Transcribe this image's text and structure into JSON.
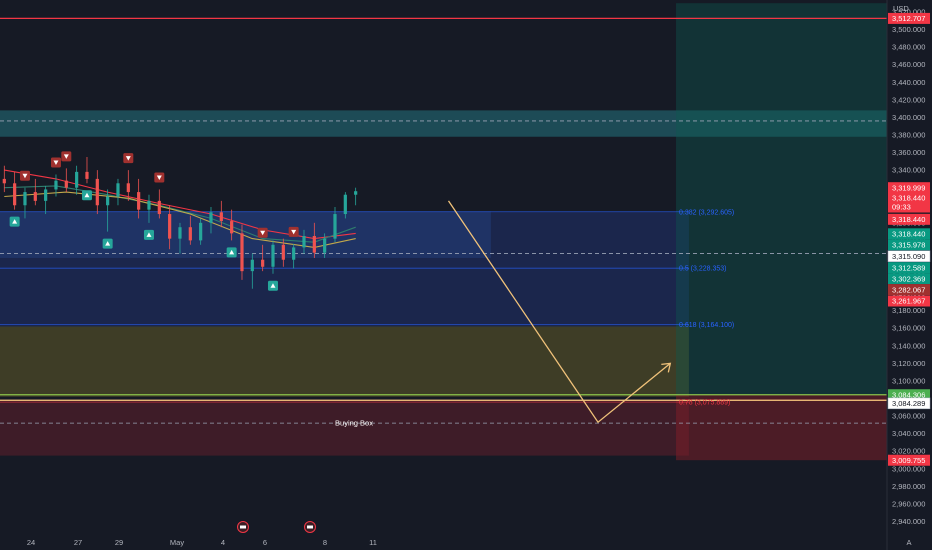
{
  "chart_data": {
    "type": "candlestick",
    "currency": "USD",
    "ylim": [
      2930,
      3530
    ],
    "y_ticks": [
      3520,
      3500,
      3480,
      3460,
      3440,
      3420,
      3400,
      3380,
      3360,
      3340,
      3320,
      3300,
      3280,
      3260,
      3240,
      3220,
      3200,
      3180,
      3160,
      3140,
      3120,
      3100,
      3080,
      3060,
      3040,
      3020,
      3000,
      2980,
      2960,
      2940
    ],
    "y_tick_labels": [
      "3,520.000",
      "3,500.000",
      "3,480.000",
      "3,460.000",
      "3,440.000",
      "3,420.000",
      "3,400.000",
      "3,380.000",
      "3,360.000",
      "3,340.000",
      "3,320.000",
      "3,300.000",
      "3,280.000",
      "3,260.000",
      "3,240.000",
      "3,220.000",
      "3,200.000",
      "3,180.000",
      "3,160.000",
      "3,140.000",
      "3,120.000",
      "3,100.000",
      "3,080.000",
      "3,060.000",
      "3,040.000",
      "3,020.000",
      "3,000.000",
      "2,980.000",
      "2,960.000",
      "2,940.000"
    ],
    "x_tick_labels": [
      "24",
      "27",
      "29",
      "May",
      "4",
      "6",
      "8",
      "11"
    ],
    "x_tick_index": [
      2,
      7,
      12,
      18,
      24,
      29,
      35,
      41
    ],
    "x_index_max": 103,
    "price_tags": [
      {
        "label": "3,512.707",
        "value": 3512.707,
        "color": "#f23645"
      },
      {
        "label": "3,319.999",
        "value": 3319.999,
        "color": "#f23645"
      },
      {
        "label": "3,318.440",
        "value": 3308.5,
        "color": "#f23645"
      },
      {
        "label": "09:33",
        "value": 3298.0,
        "color": "#f23645"
      },
      {
        "label": "3,318.440",
        "value": 3284.0,
        "color": "#f23645"
      },
      {
        "label": "3,318.440",
        "value": 3267.5,
        "color": "#089981"
      },
      {
        "label": "3,315.978",
        "value": 3255.0,
        "color": "#089981"
      },
      {
        "label": "3,315.090",
        "value": 3242.0,
        "color": "#ffffff"
      },
      {
        "label": "3,312.589",
        "value": 3229.0,
        "color": "#089981"
      },
      {
        "label": "3,302.369",
        "value": 3216.5,
        "color": "#089981"
      },
      {
        "label": "3,282.067",
        "value": 3204.0,
        "color": "#a0312f"
      },
      {
        "label": "3,261.967",
        "value": 3191.0,
        "color": "#f23645"
      },
      {
        "label": "3,084.306",
        "value": 3084.306,
        "color": "#4caf50"
      },
      {
        "label": "3,084.289",
        "value": 3074.5,
        "color": "#ffffff"
      },
      {
        "label": "3,009.755",
        "value": 3009.755,
        "color": "#f23645"
      }
    ],
    "candles": [
      [
        0,
        3330,
        3345,
        3315,
        3325
      ],
      [
        1,
        3325,
        3338,
        3295,
        3300
      ],
      [
        2,
        3300,
        3320,
        3285,
        3315
      ],
      [
        3,
        3315,
        3330,
        3300,
        3305
      ],
      [
        4,
        3305,
        3322,
        3290,
        3318
      ],
      [
        5,
        3318,
        3335,
        3310,
        3328
      ],
      [
        6,
        3328,
        3342,
        3315,
        3320
      ],
      [
        7,
        3320,
        3345,
        3312,
        3338
      ],
      [
        8,
        3338,
        3355,
        3325,
        3330
      ],
      [
        9,
        3330,
        3340,
        3290,
        3300
      ],
      [
        10,
        3300,
        3318,
        3270,
        3310
      ],
      [
        11,
        3310,
        3330,
        3300,
        3325
      ],
      [
        12,
        3325,
        3340,
        3305,
        3315
      ],
      [
        13,
        3315,
        3330,
        3285,
        3295
      ],
      [
        14,
        3295,
        3312,
        3280,
        3305
      ],
      [
        15,
        3305,
        3318,
        3285,
        3290
      ],
      [
        16,
        3290,
        3300,
        3250,
        3262
      ],
      [
        17,
        3262,
        3280,
        3245,
        3275
      ],
      [
        18,
        3275,
        3288,
        3255,
        3260
      ],
      [
        19,
        3260,
        3285,
        3255,
        3280
      ],
      [
        20,
        3280,
        3298,
        3268,
        3292
      ],
      [
        21,
        3292,
        3305,
        3275,
        3282
      ],
      [
        22,
        3282,
        3295,
        3260,
        3268
      ],
      [
        23,
        3268,
        3278,
        3215,
        3225
      ],
      [
        24,
        3225,
        3245,
        3205,
        3238
      ],
      [
        25,
        3238,
        3255,
        3225,
        3230
      ],
      [
        26,
        3230,
        3260,
        3222,
        3255
      ],
      [
        27,
        3255,
        3262,
        3230,
        3238
      ],
      [
        28,
        3238,
        3256,
        3228,
        3252
      ],
      [
        29,
        3252,
        3272,
        3245,
        3265
      ],
      [
        30,
        3265,
        3280,
        3240,
        3246
      ],
      [
        31,
        3246,
        3268,
        3240,
        3262
      ],
      [
        32,
        3262,
        3298,
        3258,
        3290
      ],
      [
        33,
        3290,
        3315,
        3285,
        3312
      ],
      [
        34,
        3312,
        3320,
        3300,
        3316
      ]
    ],
    "ma_lines": [
      {
        "name": "",
        "color": "#f23645",
        "values": [
          [
            0,
            3340
          ],
          [
            5,
            3330
          ],
          [
            10,
            3315
          ],
          [
            15,
            3302
          ],
          [
            20,
            3290
          ],
          [
            25,
            3272
          ],
          [
            30,
            3262
          ],
          [
            34,
            3268
          ]
        ]
      },
      {
        "name": "",
        "color": "#2f7d6d",
        "values": [
          [
            0,
            3320
          ],
          [
            5,
            3322
          ],
          [
            10,
            3312
          ],
          [
            15,
            3300
          ],
          [
            20,
            3285
          ],
          [
            25,
            3262
          ],
          [
            30,
            3258
          ],
          [
            34,
            3275
          ]
        ]
      },
      {
        "name": "",
        "color": "#c2a84b",
        "values": [
          [
            0,
            3310
          ],
          [
            6,
            3315
          ],
          [
            12,
            3308
          ],
          [
            18,
            3290
          ],
          [
            24,
            3262
          ],
          [
            30,
            3252
          ],
          [
            34,
            3262
          ]
        ]
      }
    ],
    "zones": [
      {
        "name": "resistance-band",
        "y": [
          3378,
          3408
        ],
        "x": [
          0,
          103
        ],
        "color": "rgba(41,150,160,0.40)"
      },
      {
        "name": "consolidation-box",
        "y": [
          3240,
          3293
        ],
        "x": [
          0,
          57
        ],
        "color": "rgba(41,98,175,0.40)"
      },
      {
        "name": "fib-box-upper",
        "y": [
          3162,
          3293
        ],
        "x": [
          0,
          80
        ],
        "color": "rgba(33,50,110,0.55)"
      },
      {
        "name": "fib-box-yellow",
        "y": [
          3082,
          3162
        ],
        "x": [
          0,
          80
        ],
        "color": "rgba(110,105,40,0.45)"
      },
      {
        "name": "fib-box-red",
        "y": [
          3015,
          3078
        ],
        "x": [
          0,
          80
        ],
        "color": "rgba(110,30,45,0.45)"
      },
      {
        "name": "target-zone",
        "y": [
          3084.3,
          3530
        ],
        "x": [
          78.5,
          103
        ],
        "color": "rgba(12,90,80,0.40)"
      },
      {
        "name": "stop-zone",
        "y": [
          3009.8,
          3084.3
        ],
        "x": [
          78.5,
          103
        ],
        "color": "rgba(130,30,40,0.50)"
      }
    ],
    "fib_levels": [
      {
        "label": "0.382 (3,292.605)",
        "value": 3292.605,
        "color": "#2962ff"
      },
      {
        "label": "0.5 (3,228.353)",
        "value": 3228.353,
        "color": "#2962ff"
      },
      {
        "label": "0.618 (3,164.100)",
        "value": 3164.1,
        "color": "#2962ff"
      },
      {
        "label": "0.78 (3,075.889)",
        "value": 3075.889,
        "color": "#f23645"
      }
    ],
    "h_lines": [
      {
        "value": 3512.707,
        "color": "#f23645",
        "style": "solid"
      },
      {
        "value": 3396,
        "color": "#9aa3b5",
        "style": "dashed"
      },
      {
        "value": 3245,
        "color": "#9aa3b5",
        "style": "dashed"
      },
      {
        "value": 3084.306,
        "color": "#8bc34a",
        "style": "solid"
      },
      {
        "value": 3078,
        "color": "#ffcc80",
        "style": "solid"
      },
      {
        "value": 3052,
        "color": "#9aa3b5",
        "style": "dashed"
      }
    ],
    "projection_path": [
      [
        46.5,
        3305
      ],
      [
        62,
        3053
      ],
      [
        69.5,
        3120
      ]
    ],
    "annotation": {
      "text": "Buying Box",
      "value": 3052,
      "x": 42
    },
    "buy_signal_index": [
      1,
      8,
      10,
      14,
      22,
      26
    ],
    "sell_signal_index": [
      2,
      5,
      6,
      12,
      15,
      25,
      28
    ]
  },
  "footer": {
    "label": "A"
  }
}
